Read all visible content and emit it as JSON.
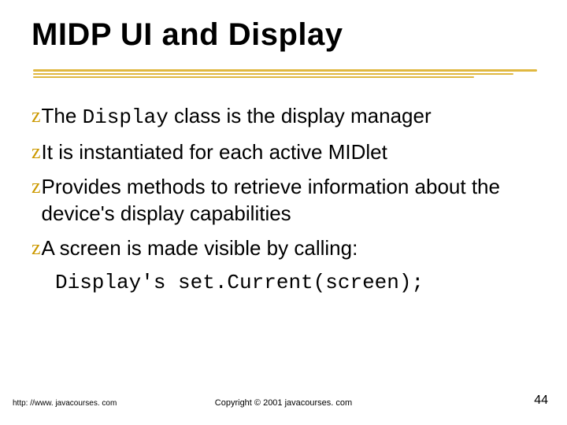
{
  "slide": {
    "title": "MIDP UI and Display",
    "bullets": [
      {
        "pre": "The ",
        "code": "Display",
        "post": " class is the display manager"
      },
      {
        "pre": "It is instantiated for each active MIDlet",
        "code": "",
        "post": ""
      },
      {
        "pre": "Provides methods to retrieve information about the device's display capabilities",
        "code": "",
        "post": ""
      },
      {
        "pre": "A screen is made visible by calling:",
        "code": "",
        "post": ""
      }
    ],
    "code_line": "Display's set.Current(screen);",
    "bullet_glyph": "z"
  },
  "footer": {
    "url": "http: //www. javacourses. com",
    "copyright": "Copyright © 2001 javacourses. com",
    "page_number": "44"
  }
}
